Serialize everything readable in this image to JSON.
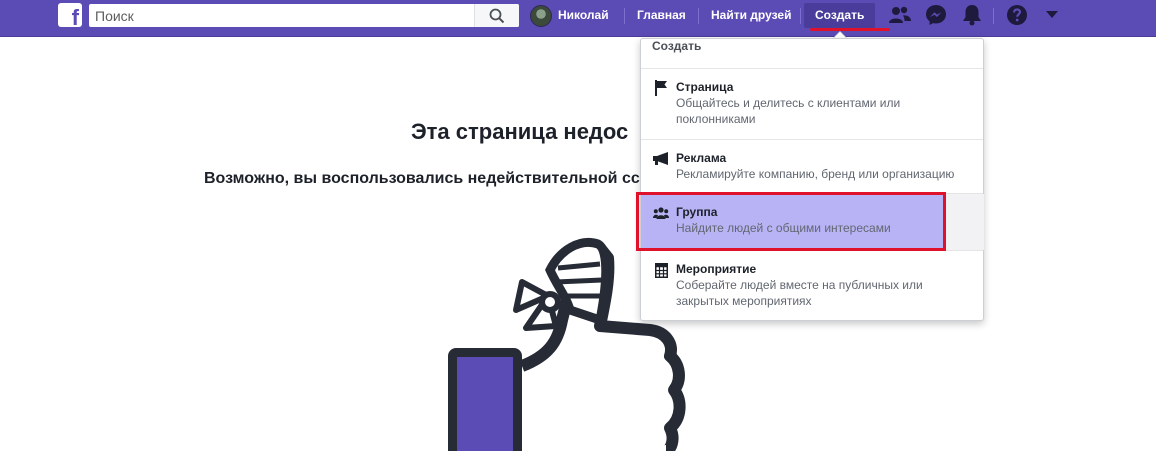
{
  "header": {
    "logo_letter": "f",
    "search": {
      "placeholder": "Поиск",
      "value": ""
    },
    "profile_name": "Николай",
    "home_label": "Главная",
    "find_friends_label": "Найти друзей",
    "create_label": "Создать"
  },
  "page": {
    "title": "Эта страница недос",
    "subtitle": "Возможно, вы воспользовались недействительной сс"
  },
  "create_menu": {
    "header": "Создать",
    "items": [
      {
        "icon": "flag-icon",
        "title": "Страница",
        "desc_line1": "Общайтесь и делитесь с клиентами или",
        "desc_line2": "поклонниками"
      },
      {
        "icon": "megaphone-icon",
        "title": "Реклама",
        "desc_line1": "Рекламируйте компанию, бренд или организацию",
        "desc_line2": ""
      },
      {
        "icon": "group-icon",
        "title": "Группа",
        "desc_line1": "Найдите людей с общими интересами",
        "desc_line2": ""
      },
      {
        "icon": "calendar-icon",
        "title": "Мероприятие",
        "desc_line1": "Соберайте людей вместе на публичных или",
        "desc_line2": "закрытых мероприятиях"
      }
    ]
  },
  "colors": {
    "topbar": "#5b4bb5",
    "highlight": "#b8b3f5",
    "annotation_red": "#e0112b"
  }
}
